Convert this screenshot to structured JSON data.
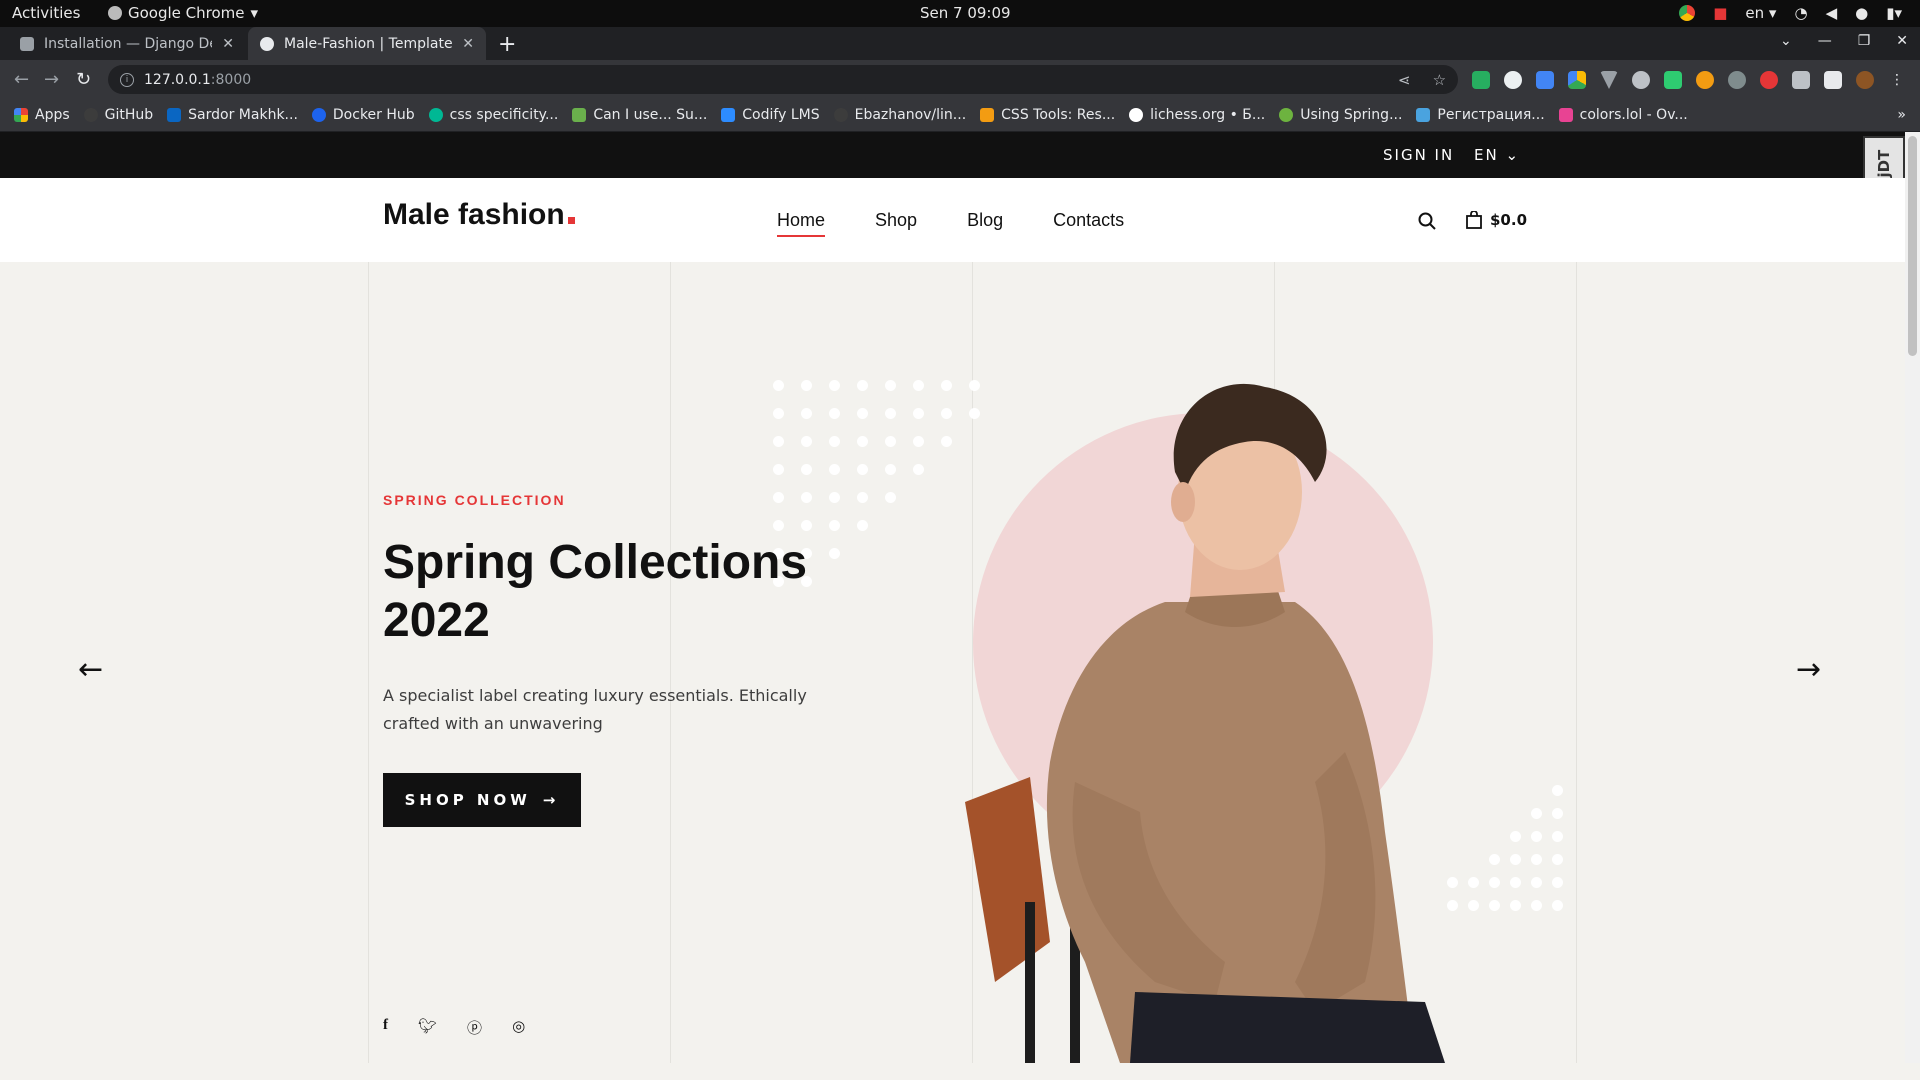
{
  "system_bar": {
    "activities": "Activities",
    "app_name": "Google Chrome",
    "clock": "Sen 7  09:09",
    "lang": "en"
  },
  "tabs": [
    {
      "title": "Installation — Django De",
      "active": false
    },
    {
      "title": "Male-Fashion | Template",
      "active": true
    }
  ],
  "toolbar": {
    "url_host": "127.0.0.1",
    "url_port": ":8000"
  },
  "bookmarks": [
    {
      "label": "Apps",
      "color": "#ea4335"
    },
    {
      "label": "GitHub",
      "color": "#3c3c3c"
    },
    {
      "label": "Sardor Makhk...",
      "color": "#0a66c2"
    },
    {
      "label": "Docker Hub",
      "color": "#1d63ed"
    },
    {
      "label": "css specificity...",
      "color": "#00b894"
    },
    {
      "label": "Can I use... Su...",
      "color": "#6ab04c"
    },
    {
      "label": "Codify LMS",
      "color": "#2d8cff"
    },
    {
      "label": "Ebazhanov/lin...",
      "color": "#3c3c3c"
    },
    {
      "label": "CSS Tools: Res...",
      "color": "#f39c12"
    },
    {
      "label": "lichess.org • Б...",
      "color": "#ffffff"
    },
    {
      "label": "Using Spring...",
      "color": "#6db33f"
    },
    {
      "label": "Регистрация...",
      "color": "#4aa3df"
    },
    {
      "label": "colors.lol - Ov...",
      "color": "#e84393"
    }
  ],
  "site": {
    "topbar": {
      "signin": "SIGN IN",
      "lang": "EN"
    },
    "djdt": "DjDT",
    "logo": "Male fashion",
    "nav": [
      {
        "label": "Home",
        "active": true
      },
      {
        "label": "Shop",
        "active": false
      },
      {
        "label": "Blog",
        "active": false
      },
      {
        "label": "Contacts",
        "active": false
      }
    ],
    "cart_total": "$0.0",
    "hero": {
      "eyebrow": "SPRING COLLECTION",
      "title": "Spring Collections 2022",
      "text": "A specialist label creating luxury essentials. Ethically crafted with an unwavering",
      "button": "SHOP NOW",
      "prev": "←",
      "next": "→"
    },
    "socials": [
      "facebook-icon",
      "twitter-icon",
      "pinterest-icon",
      "instagram-icon"
    ],
    "accent": "#e53637"
  }
}
